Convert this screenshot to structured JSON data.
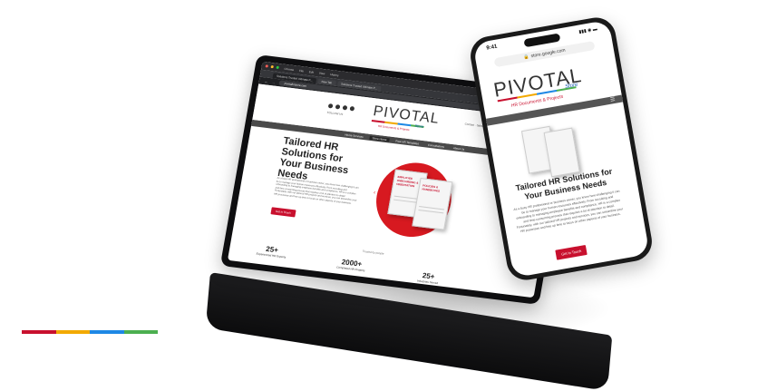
{
  "colors": {
    "red": "#c8102e",
    "yellow": "#f2a900",
    "blue": "#1e88e5",
    "green": "#4caf50",
    "brand_red": "#d71920"
  },
  "stripe": [
    "#c8102e",
    "#f2a900",
    "#1e88e5",
    "#4caf50"
  ],
  "laptop": {
    "browser": {
      "menu": [
        "Chrome",
        "File",
        "Edit",
        "View",
        "History",
        "Bookmarks",
        "Profiles",
        "Tab",
        "Window",
        "Help"
      ],
      "tabs": [
        "Solutions Trusted Ultimate P...",
        "New Tab",
        "Solutions Trusted Ultimate P..."
      ],
      "url": "pivotalhrstore.com"
    },
    "site": {
      "follow": "FOLLOW US",
      "logo": "PIVOTAL",
      "logo_store": "Store",
      "logo_sub": "HR Documents & Projects",
      "contact": "Contact  ·  Sales",
      "nav": [
        "Home Services",
        "Store Home",
        "Free HR Templates",
        "Consultations",
        "About Us"
      ],
      "nav_active": 1,
      "hero": {
        "title": "Tailored HR Solutions for Your Business Needs",
        "body": "As a busy HR professional or business owner, you know how challenging it can be to manage your human resources effectively. From recruiting and onboarding to managing employee benefits and compliance, HR is a complex and time-consuming process that requires a lot of attention to detail. Fortunately, with our tailored HR projects and services, you can streamline your HR processes and free up time to focus on other aspects of your business.",
        "cta": "Get in Touch",
        "book1": "EMPLOYEE ONBOARDING & ORIENTATION",
        "book2": "POLICIES & HANDBOOKS"
      },
      "trusted": "Trusted by people",
      "stats": [
        {
          "number": "25+",
          "label": "Experienced HR Experts"
        },
        {
          "number": "2000+",
          "label": "Completed HR Projects"
        },
        {
          "number": "25+",
          "label": "Industries Served"
        }
      ]
    }
  },
  "phone": {
    "time": "9:41",
    "status": "▮▮▮ ◉ ▬",
    "url": "store.google.com",
    "logo": "PIVOTAL",
    "logo_store": "Store",
    "logo_sub": "HR Documents & Projects",
    "title": "Tailored HR Solutions for Your Business Needs",
    "body": "As a busy HR professional or business owner, you know how challenging it can be to manage your human resources effectively. From recruiting and onboarding to managing employee benefits and compliance, HR is a complex and time-consuming process that requires a lot of attention to detail. Fortunately, with our tailored HR projects and services, you can streamline your HR processes and free up time to focus on other aspects of your business.",
    "cta": "Get in Touch"
  }
}
